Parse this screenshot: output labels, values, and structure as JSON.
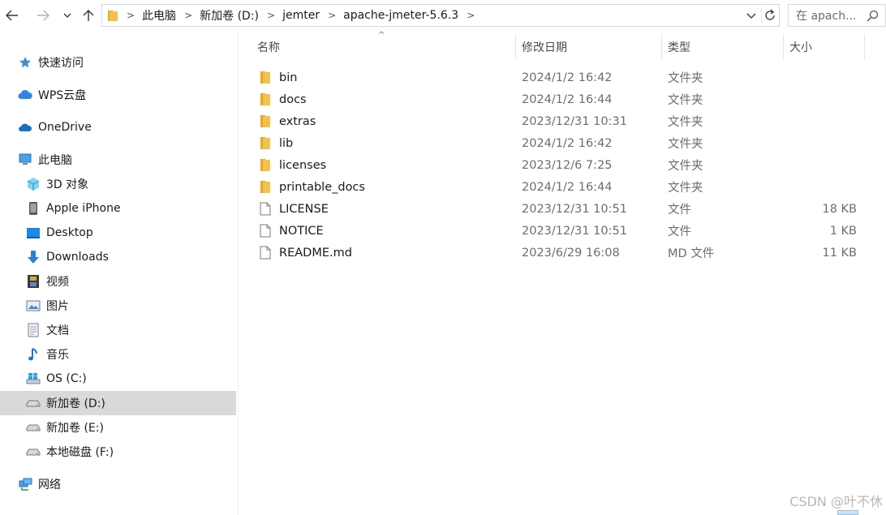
{
  "nav": {
    "back_icon": "arrow-left-icon",
    "forward_icon": "arrow-right-icon",
    "recent_icon": "chevron-down-icon",
    "up_icon": "arrow-up-icon"
  },
  "address": {
    "breadcrumbs": [
      "此电脑",
      "新加卷 (D:)",
      "jemter",
      "apache-jmeter-5.6.3"
    ]
  },
  "search": {
    "placeholder": "在 apach..."
  },
  "sidebar": {
    "items": [
      {
        "label": "快速访问",
        "icon": "star-icon"
      },
      {
        "label": "WPS云盘",
        "icon": "cloud-icon"
      },
      {
        "label": "OneDrive",
        "icon": "onedrive-icon"
      },
      {
        "label": "此电脑",
        "icon": "computer-icon"
      },
      {
        "label": "3D 对象",
        "icon": "cube-icon"
      },
      {
        "label": "Apple iPhone",
        "icon": "phone-icon"
      },
      {
        "label": "Desktop",
        "icon": "desktop-icon"
      },
      {
        "label": "Downloads",
        "icon": "download-icon"
      },
      {
        "label": "视频",
        "icon": "film-icon"
      },
      {
        "label": "图片",
        "icon": "picture-icon"
      },
      {
        "label": "文档",
        "icon": "document-icon"
      },
      {
        "label": "音乐",
        "icon": "music-icon"
      },
      {
        "label": "OS (C:)",
        "icon": "windows-drive-icon"
      },
      {
        "label": "新加卷 (D:)",
        "icon": "drive-icon"
      },
      {
        "label": "新加卷 (E:)",
        "icon": "drive-icon"
      },
      {
        "label": "本地磁盘 (F:)",
        "icon": "drive-icon"
      },
      {
        "label": "网络",
        "icon": "network-icon"
      }
    ],
    "selected": "新加卷 (D:)"
  },
  "columns": {
    "name": "名称",
    "date": "修改日期",
    "type": "类型",
    "size": "大小"
  },
  "files": [
    {
      "name": "bin",
      "date": "2024/1/2 16:42",
      "type": "文件夹",
      "size": "",
      "kind": "folder"
    },
    {
      "name": "docs",
      "date": "2024/1/2 16:44",
      "type": "文件夹",
      "size": "",
      "kind": "folder"
    },
    {
      "name": "extras",
      "date": "2023/12/31 10:31",
      "type": "文件夹",
      "size": "",
      "kind": "folder"
    },
    {
      "name": "lib",
      "date": "2024/1/2 16:42",
      "type": "文件夹",
      "size": "",
      "kind": "folder"
    },
    {
      "name": "licenses",
      "date": "2023/12/6 7:25",
      "type": "文件夹",
      "size": "",
      "kind": "folder"
    },
    {
      "name": "printable_docs",
      "date": "2024/1/2 16:44",
      "type": "文件夹",
      "size": "",
      "kind": "folder"
    },
    {
      "name": "LICENSE",
      "date": "2023/12/31 10:51",
      "type": "文件",
      "size": "18 KB",
      "kind": "file"
    },
    {
      "name": "NOTICE",
      "date": "2023/12/31 10:51",
      "type": "文件",
      "size": "1 KB",
      "kind": "file"
    },
    {
      "name": "README.md",
      "date": "2023/6/29 16:08",
      "type": "MD 文件",
      "size": "11 KB",
      "kind": "file"
    }
  ],
  "watermark": "CSDN @叶不休",
  "colors": {
    "folder": "#f2c24a",
    "selected_bg": "#d9d9d9",
    "accent": "#0078d4"
  }
}
